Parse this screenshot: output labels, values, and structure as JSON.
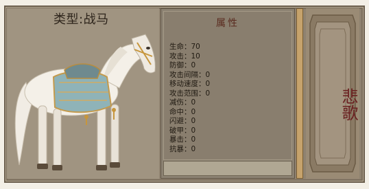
{
  "header": {
    "type_label": "类型:战马"
  },
  "attributes": {
    "heading": "属性",
    "items": [
      "生命：70",
      "攻击：10",
      "防御：0",
      "攻击间隔：0",
      "移动速度：0",
      "攻击范围：0",
      "减伤：0",
      "命中：0",
      "闪避：0",
      "破甲：0",
      "暴击：0",
      "抗暴：0"
    ]
  },
  "name_card": {
    "name": "悲歌"
  },
  "colors": {
    "panel": "#8f8270",
    "accent": "#c6a36c",
    "name": "#6b2121"
  }
}
